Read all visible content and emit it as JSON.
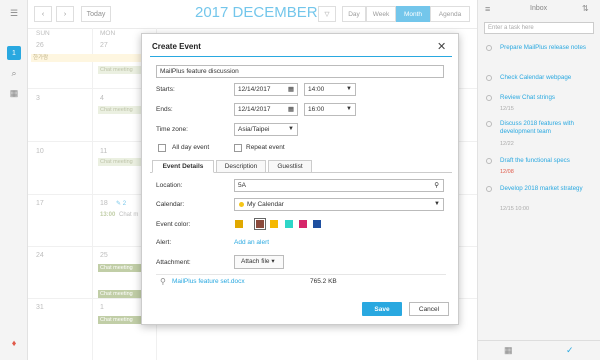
{
  "calendar": {
    "prev_icon": "chevron-left",
    "next_icon": "chevron-right",
    "today_label": "Today",
    "title": "2017 DECEMBER",
    "filter_icon": "filter",
    "views": [
      "Day",
      "Week",
      "Month",
      "Agenda"
    ],
    "active_view": "Month",
    "weekdays": [
      "SUN",
      "MON"
    ],
    "days": {
      "row1": [
        "26",
        "27"
      ],
      "row2": [
        "3",
        "4"
      ],
      "row3": [
        "10",
        "11"
      ],
      "row4": [
        "17",
        "18"
      ],
      "row5": [
        "24",
        "25"
      ],
      "row6": [
        "31",
        "1"
      ]
    },
    "events": {
      "holiday": "한가람",
      "chat1": "Chat meeting",
      "chat2": "Chat meeting",
      "chat3": "Chat meeting",
      "chat4_time": "13:00",
      "chat4": "Chat m",
      "chat5": "Chat meeting",
      "chat6": "Chat meeting",
      "chat7": "Chat meeting",
      "count_badge": "2"
    }
  },
  "dialog": {
    "title": "Create Event",
    "subject": "MailPlus feature discussion",
    "starts_label": "Starts:",
    "starts_date": "12/14/2017",
    "starts_time": "14:00",
    "ends_label": "Ends:",
    "ends_date": "12/14/2017",
    "ends_time": "16:00",
    "timezone_label": "Time zone:",
    "timezone": "Asia/Taipei",
    "all_day_label": "All day event",
    "repeat_label": "Repeat event",
    "tabs": [
      "Event Details",
      "Description",
      "Guestlist"
    ],
    "location_label": "Location:",
    "location": "5A",
    "calendar_label": "Calendar:",
    "calendar_value": "My Calendar",
    "calendar_color": "#f5c518",
    "event_color_label": "Event color:",
    "event_colors": [
      "#e0a800",
      "#8b4a3c",
      "#f5b800",
      "#2ed6c8",
      "#d6266a",
      "#1e4fa0"
    ],
    "alert_label": "Alert:",
    "alert_link": "Add an alert",
    "attachment_label": "Attachment:",
    "attach_btn": "Attach file",
    "file_name": "MailPlus feature set.docx",
    "file_size": "765.2 KB",
    "save": "Save",
    "cancel": "Cancel"
  },
  "inbox": {
    "title": "Inbox",
    "placeholder": "Enter a task here",
    "tasks": [
      {
        "text": "Prepare MailPlus release notes",
        "date": ""
      },
      {
        "text": "Check Calendar webpage",
        "date": ""
      },
      {
        "text": "Review Chat strings",
        "date": "12/15"
      },
      {
        "text": "Discuss 2018 features with development team",
        "date": "12/22"
      },
      {
        "text": "Draft the functional specs",
        "date": "12/08"
      },
      {
        "text": "Develop 2018 market strategy",
        "date": "12/15  10:00"
      }
    ]
  },
  "colors": {
    "accent": "#29a8e0",
    "event_green": "#a0b478",
    "overdue": "#e05a4a"
  }
}
